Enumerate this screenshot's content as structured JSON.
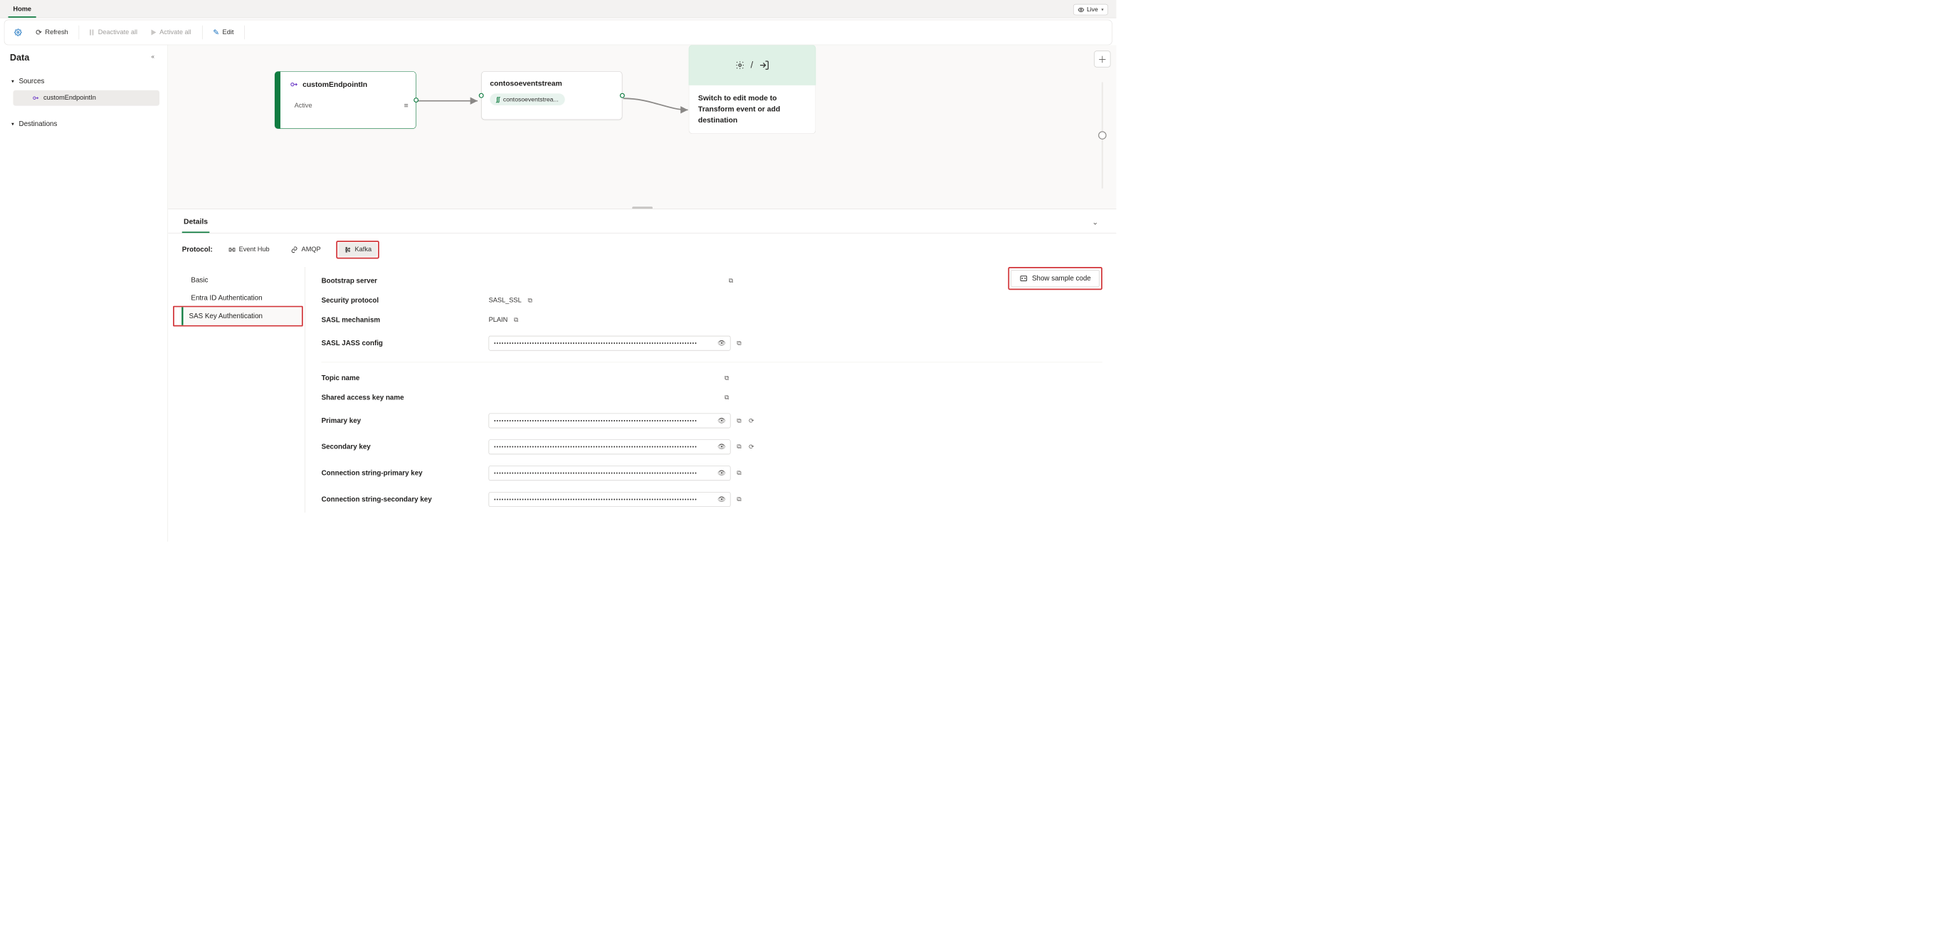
{
  "topTabs": {
    "home": "Home"
  },
  "livePill": {
    "label": "Live"
  },
  "toolbar": {
    "refresh": "Refresh",
    "deactivateAll": "Deactivate all",
    "activateAll": "Activate all",
    "edit": "Edit"
  },
  "sidebar": {
    "title": "Data",
    "sections": {
      "sources": {
        "label": "Sources",
        "items": [
          {
            "label": "customEndpointIn"
          }
        ]
      },
      "destinations": {
        "label": "Destinations"
      }
    }
  },
  "canvas": {
    "sourceNode": {
      "title": "customEndpointIn",
      "status": "Active"
    },
    "streamNode": {
      "title": "contosoeventstream",
      "chip": "contosoeventstrea..."
    },
    "destNode": {
      "iconSep": "/",
      "text": "Switch to edit mode to Transform event or add destination"
    }
  },
  "details": {
    "tab": "Details",
    "protocolLabel": "Protocol:",
    "protocols": {
      "eventhub": "Event Hub",
      "amqp": "AMQP",
      "kafka": "Kafka"
    },
    "authTabs": {
      "basic": "Basic",
      "entra": "Entra ID Authentication",
      "sas": "SAS Key Authentication"
    },
    "sampleCode": "Show sample code",
    "fields": {
      "bootstrap": {
        "label": "Bootstrap server",
        "value": ""
      },
      "secproto": {
        "label": "Security protocol",
        "value": "SASL_SSL"
      },
      "saslmech": {
        "label": "SASL mechanism",
        "value": "PLAIN"
      },
      "jass": {
        "label": "SASL JASS config"
      },
      "topic": {
        "label": "Topic name",
        "value": ""
      },
      "sakname": {
        "label": "Shared access key name",
        "value": ""
      },
      "pkey": {
        "label": "Primary key"
      },
      "skey": {
        "label": "Secondary key"
      },
      "csp": {
        "label": "Connection string-primary key"
      },
      "css": {
        "label": "Connection string-secondary key"
      }
    },
    "dots": "••••••••••••••••••••••••••••••••••••••••••••••••••••••••••••••••••••••••••••••••"
  }
}
